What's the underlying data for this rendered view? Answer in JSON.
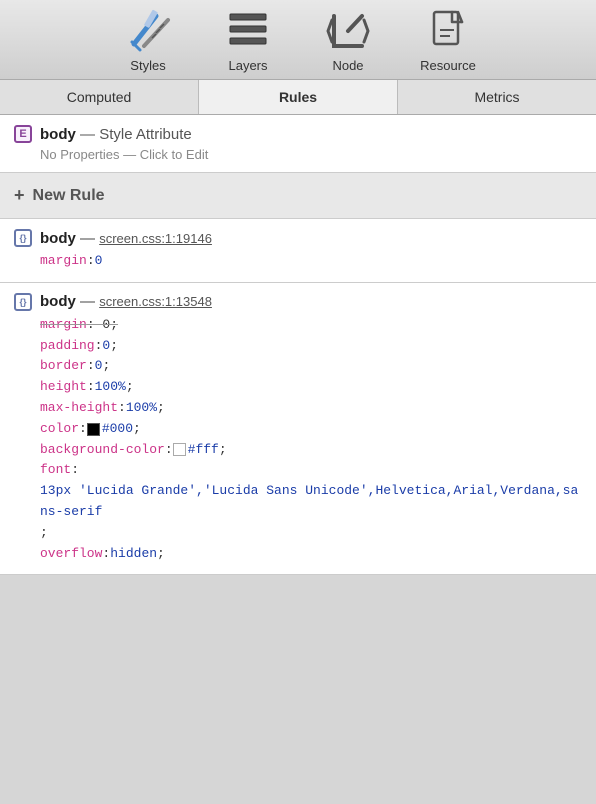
{
  "toolbar": {
    "items": [
      {
        "id": "styles",
        "label": "Styles"
      },
      {
        "id": "layers",
        "label": "Layers"
      },
      {
        "id": "node",
        "label": "Node"
      },
      {
        "id": "resource",
        "label": "Resource"
      }
    ]
  },
  "tabs": {
    "items": [
      {
        "id": "computed",
        "label": "Computed",
        "active": false
      },
      {
        "id": "rules",
        "label": "Rules",
        "active": true
      },
      {
        "id": "metrics",
        "label": "Metrics",
        "active": false
      }
    ]
  },
  "new_rule": {
    "plus": "+",
    "label": "New Rule"
  },
  "rule1": {
    "selector": "body",
    "dash": "—",
    "no_props": "No Properties — Click to Edit",
    "source_text": "Style Attribute"
  },
  "rule2": {
    "selector": "body",
    "dash": "—",
    "source": "screen.css:1:19146",
    "prop1_name": "margin",
    "prop1_value": "0"
  },
  "rule3": {
    "selector": "body",
    "dash": "—",
    "source": "screen.css:1:13548"
  }
}
